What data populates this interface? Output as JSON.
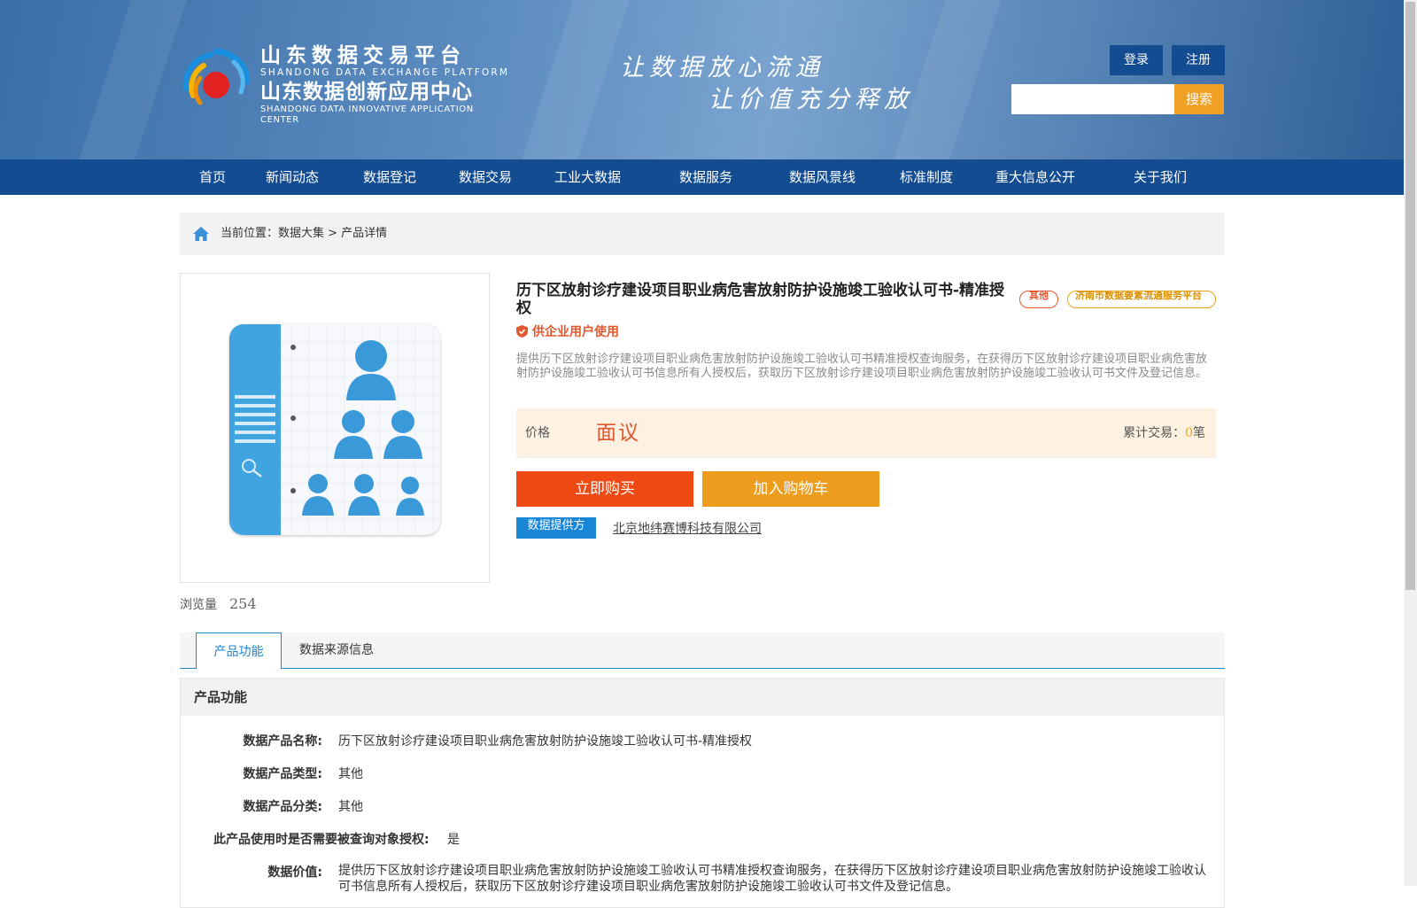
{
  "header": {
    "logo": {
      "cn_title": "山东数据交易平台",
      "en_title": "SHANDONG DATA EXCHANGE PLATFORM",
      "cn_subtitle": "山东数据创新应用中心",
      "en_subtitle": "SHANDONG DATA INNOVATIVE APPLICATION CENTER"
    },
    "slogan_line1": "让数据放心流通",
    "slogan_line2": "让价值充分释放",
    "login_label": "登录",
    "register_label": "注册",
    "search_placeholder": "",
    "search_label": "搜索"
  },
  "nav": {
    "items": [
      "首页",
      "新闻动态",
      "数据登记",
      "数据交易",
      "工业大数据",
      "数据服务",
      "数据风景线",
      "标准制度",
      "重大信息公开",
      "关于我们"
    ]
  },
  "breadcrumb": {
    "text": "当前位置：数据大集 > 产品详情"
  },
  "product": {
    "title": "历下区放射诊疗建设项目职业病危害放射防护设施竣工验收认可书-精准授权",
    "tag_category": "其他",
    "tag_platform": "济南市数据要素流通服务平台",
    "audience": "供企业用户使用",
    "description": "提供历下区放射诊疗建设项目职业病危害放射防护设施竣工验收认可书精准授权查询服务，在获得历下区放射诊疗建设项目职业病危害放射防护设施竣工验收认可书信息所有人授权后，获取历下区放射诊疗建设项目职业病危害放射防护设施竣工验收认可书文件及登记信息。",
    "price_label": "价格",
    "price_value": "面议",
    "trade_prefix": "累计交易：",
    "trade_count": "0",
    "trade_suffix": "笔",
    "buy_label": "立即购买",
    "cart_label": "加入购物车",
    "provider_label": "数据提供方",
    "provider_name": "北京地纬赛博科技有限公司",
    "views_label": "浏览量",
    "views_count": "254"
  },
  "tabs": {
    "active": "产品功能",
    "inactive": "数据来源信息"
  },
  "details": {
    "heading": "产品功能",
    "rows": [
      {
        "label": "数据产品名称:",
        "value": "历下区放射诊疗建设项目职业病危害放射防护设施竣工验收认可书-精准授权"
      },
      {
        "label": "数据产品类型:",
        "value": "其他"
      },
      {
        "label": "数据产品分类:",
        "value": "其他"
      },
      {
        "label": "此产品使用时是否需要被查询对象授权:",
        "value": "是"
      },
      {
        "label": "数据价值:",
        "value": "提供历下区放射诊疗建设项目职业病危害放射防护设施竣工验收认可书精准授权查询服务，在获得历下区放射诊疗建设项目职业病危害放射防护设施竣工验收认可书信息所有人授权后，获取历下区放射诊疗建设项目职业病危害放射防护设施竣工验收认可书文件及登记信息。"
      }
    ]
  },
  "colors": {
    "nav_blue": "#134c91",
    "accent_orange": "#ef4a14",
    "accent_amber": "#ee9c1e",
    "link_blue": "#1a87d6"
  }
}
